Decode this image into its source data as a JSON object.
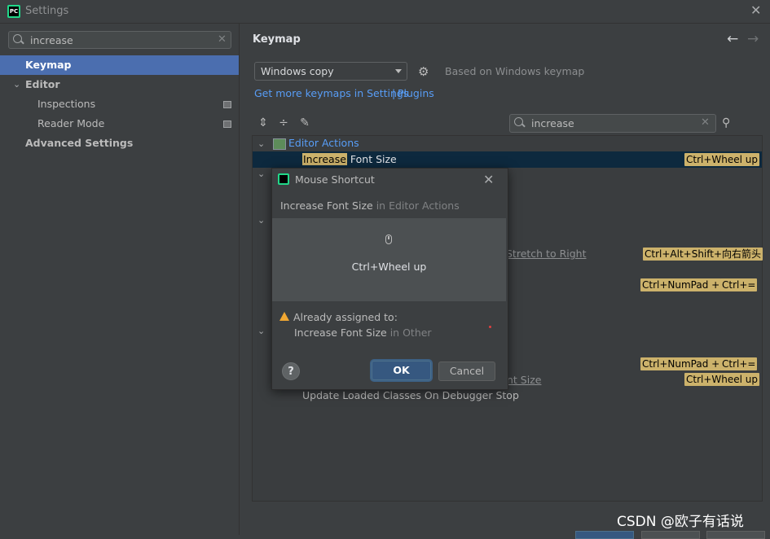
{
  "window": {
    "title": "Settings",
    "app_icon": "pycharm-icon",
    "close_icon": "close-icon"
  },
  "left": {
    "search": {
      "value": "increase"
    },
    "items": [
      {
        "label": "Keymap",
        "selected": true
      },
      {
        "label": "Editor",
        "expanded": true
      },
      {
        "label": "Inspections"
      },
      {
        "label": "Reader Mode"
      },
      {
        "label": "Advanced Settings"
      }
    ]
  },
  "header": {
    "title": "Keymap"
  },
  "keymap": {
    "selected": "Windows copy",
    "based_on": "Based on Windows keymap",
    "link_more": "Get more keymaps in Settings",
    "link_sep": "|",
    "link_plugins": "Plugins",
    "search": {
      "value": "increase"
    }
  },
  "tree": {
    "group1": "Editor Actions",
    "selected_row": {
      "match": "Increase",
      "rest": " Font Size",
      "shortcut": "Ctrl+Wheel up"
    },
    "partial1": "Stretch to Right",
    "partial2": "nt Size",
    "last_row": "Update Loaded Classes On Debugger Stop",
    "shortcuts": {
      "stretch": "Ctrl+Alt+Shift+向右箭头",
      "numpad1": "Ctrl+NumPad +",
      "eq1": "Ctrl+=",
      "numpad2": "Ctrl+NumPad +",
      "eq2": "Ctrl+=",
      "wheel2": "Ctrl+Wheel up"
    }
  },
  "dialog": {
    "title": "Mouse Shortcut",
    "action": "Increase Font Size",
    "action_ctx": " in Editor Actions",
    "shortcut": "Ctrl+Wheel up",
    "warning": "Already assigned to:",
    "conflict": "Increase Font Size",
    "conflict_ctx": " in Other",
    "help": "?",
    "ok": "OK",
    "cancel": "Cancel"
  },
  "watermark": "CSDN @欧子有话说",
  "colors": {
    "accent": "#4b6eaf",
    "highlight": "#ccb26b",
    "link": "#589df6",
    "selected_row": "#0d293e"
  }
}
